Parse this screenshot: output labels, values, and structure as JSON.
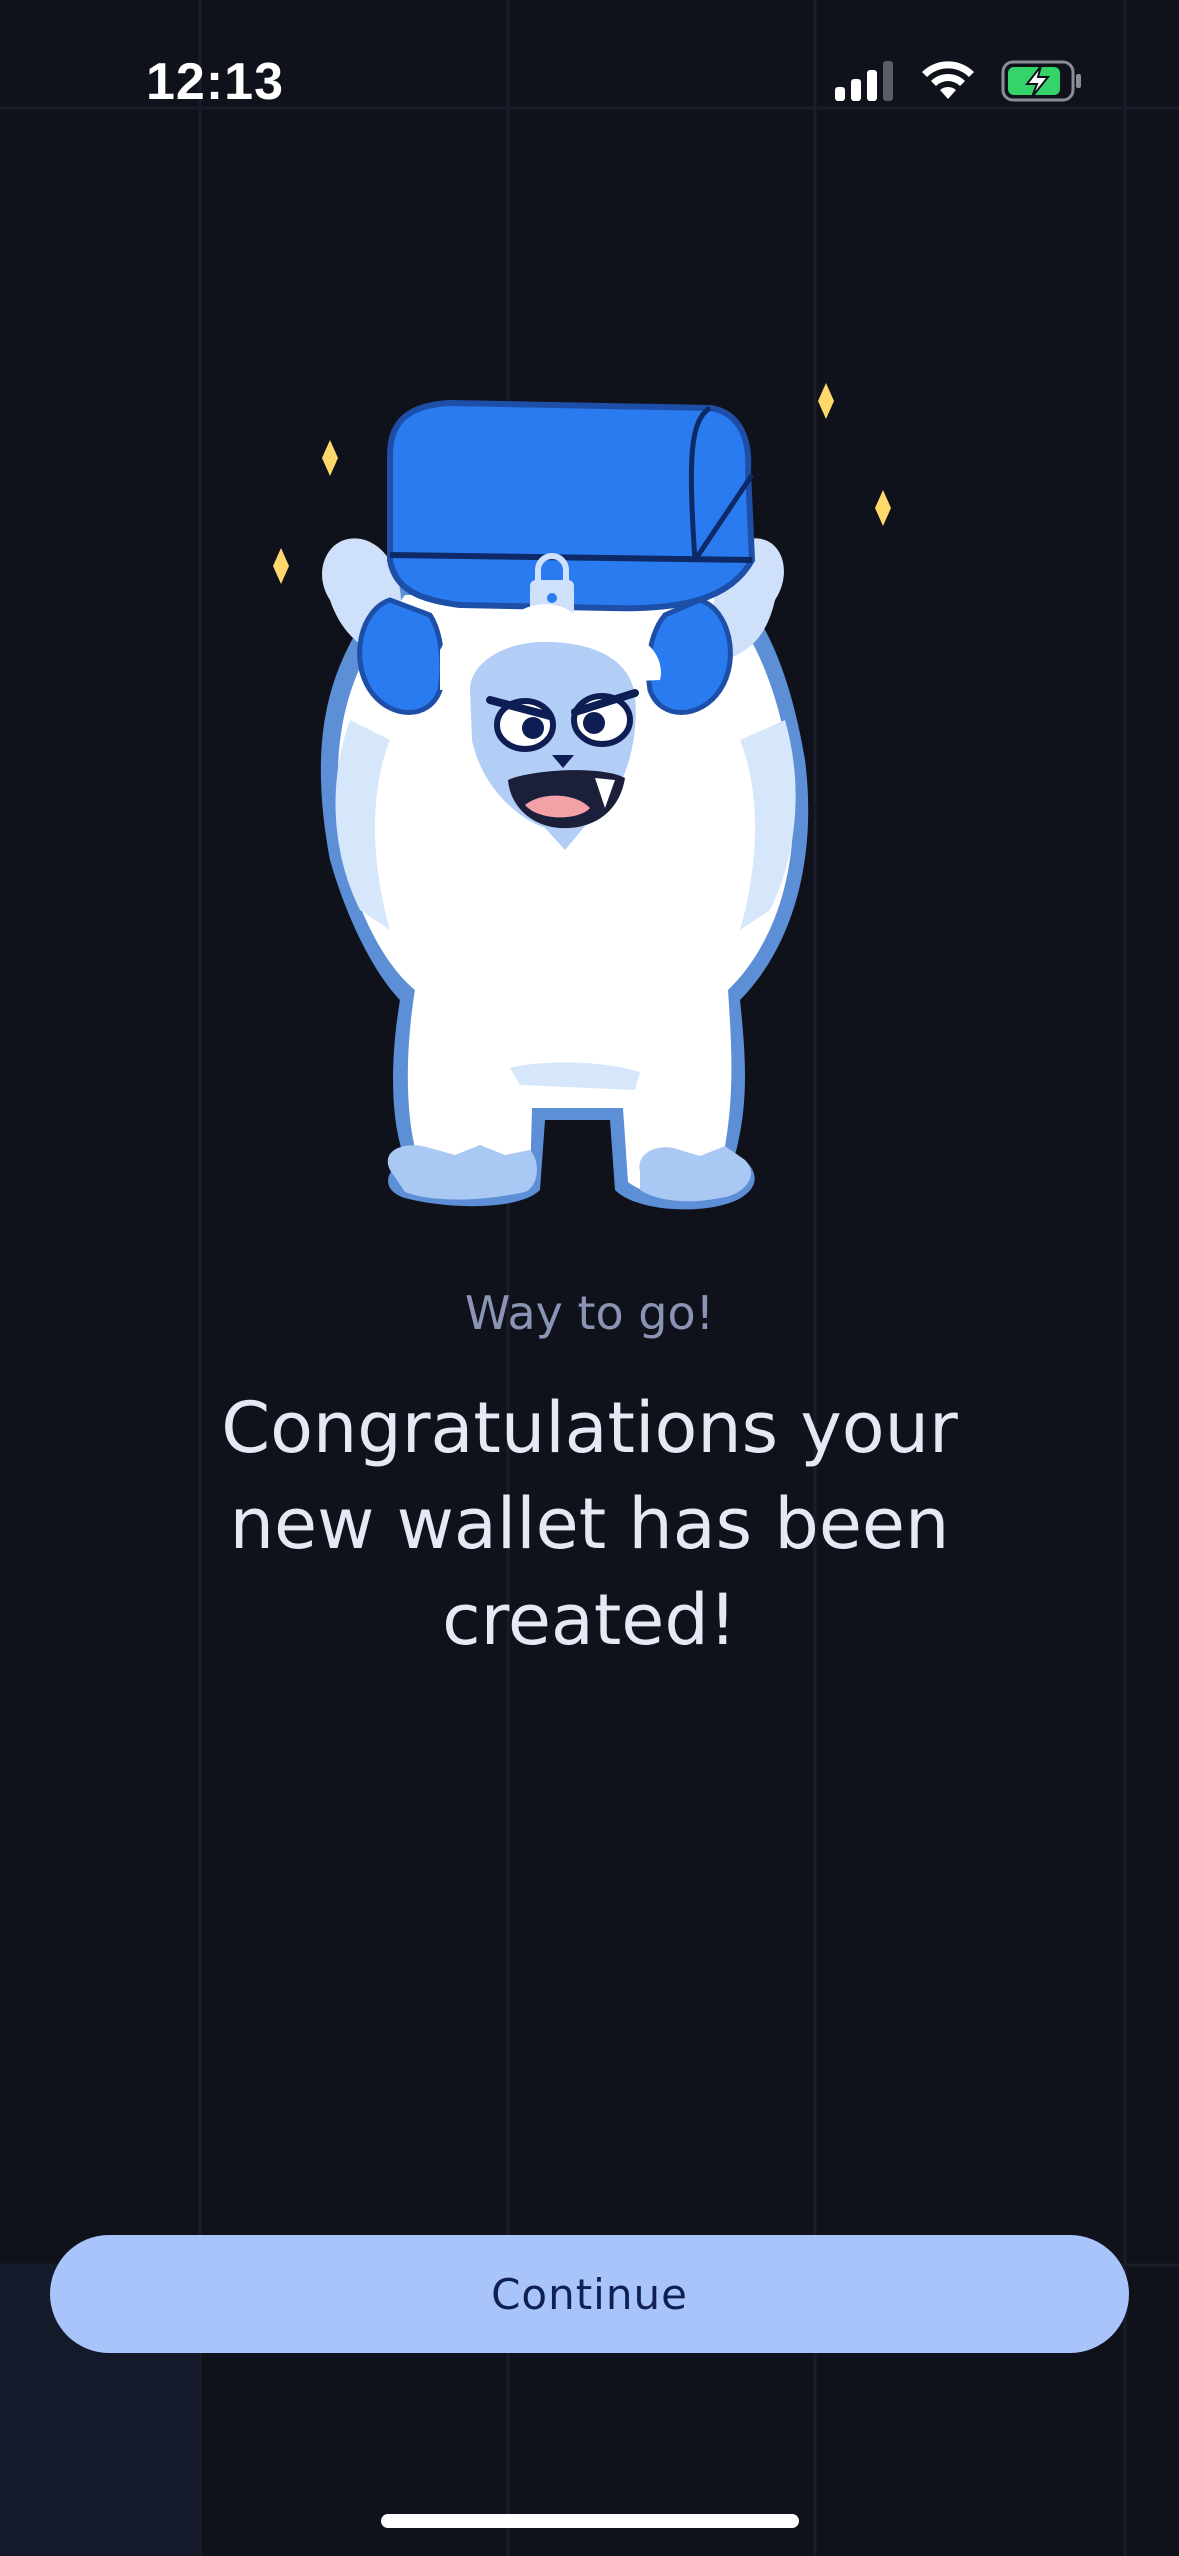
{
  "status_bar": {
    "time": "12:13",
    "signal_icon": "cellular-signal-icon",
    "wifi_icon": "wifi-icon",
    "battery_icon": "battery-charging-icon"
  },
  "illustration": {
    "icon": "yeti-holding-chest-illustration"
  },
  "content": {
    "subtitle": "Way to go!",
    "headline": "Congratulations your new wallet has been created!"
  },
  "actions": {
    "continue_label": "Continue"
  },
  "colors": {
    "background": "#10121b",
    "button": "#a9c4fb",
    "button_text": "#102050",
    "subtitle": "#8c94b5",
    "headline": "#e6e9f5",
    "battery_charging": "#35d46a"
  }
}
